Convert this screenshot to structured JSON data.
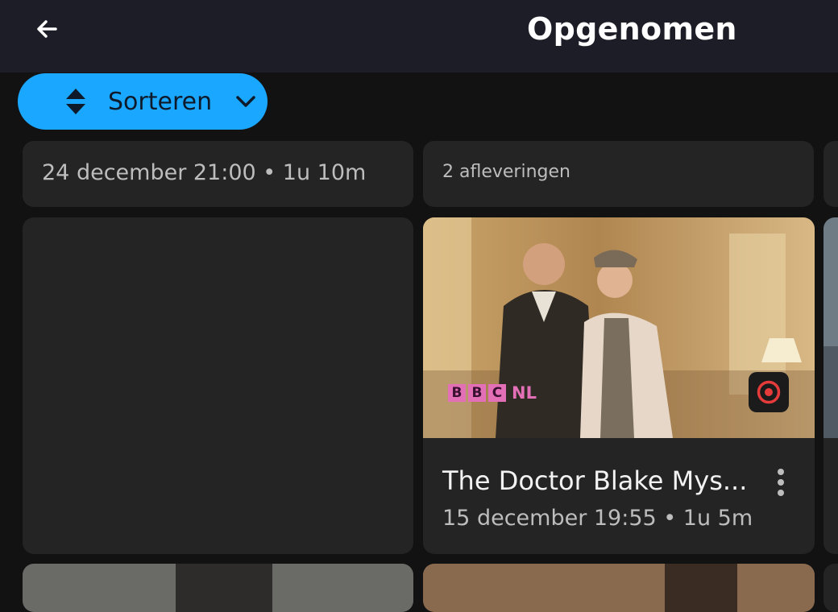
{
  "header": {
    "title": "Opgenomen",
    "back_icon": "arrow-left-icon"
  },
  "sort": {
    "label": "Sorteren",
    "icon": "sort-icon",
    "chevron": "chevron-down-icon"
  },
  "recordings": [
    {
      "meta": "24 december 21:00 • 1u 10m"
    },
    {
      "meta": "2 afleveringen"
    },
    {
      "title": "",
      "meta": ""
    },
    {
      "title": "The Doctor Blake Mys...",
      "meta": "15 december 19:55 • 1u 5m",
      "channel": {
        "blocks": [
          "B",
          "B",
          "C"
        ],
        "suffix": "NL"
      },
      "badge_icon": "record-icon"
    }
  ],
  "colors": {
    "accent": "#1aa7ff",
    "topbar": "#1c1d26",
    "card": "#242424",
    "record": "#e63b3b",
    "channel_logo": "#e36fb6"
  }
}
